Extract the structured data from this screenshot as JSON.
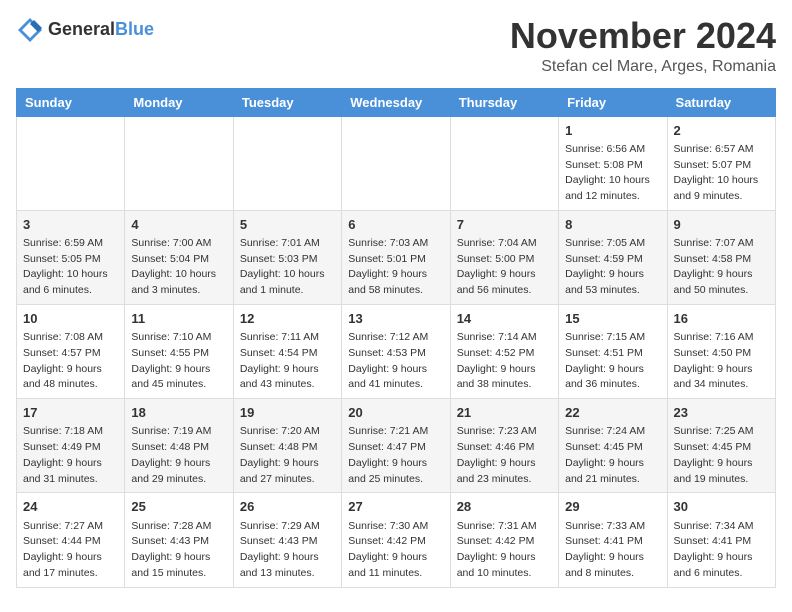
{
  "logo": {
    "general": "General",
    "blue": "Blue"
  },
  "header": {
    "month": "November 2024",
    "location": "Stefan cel Mare, Arges, Romania"
  },
  "weekdays": [
    "Sunday",
    "Monday",
    "Tuesday",
    "Wednesday",
    "Thursday",
    "Friday",
    "Saturday"
  ],
  "weeks": [
    [
      {
        "day": "",
        "info": ""
      },
      {
        "day": "",
        "info": ""
      },
      {
        "day": "",
        "info": ""
      },
      {
        "day": "",
        "info": ""
      },
      {
        "day": "",
        "info": ""
      },
      {
        "day": "1",
        "info": "Sunrise: 6:56 AM\nSunset: 5:08 PM\nDaylight: 10 hours and 12 minutes."
      },
      {
        "day": "2",
        "info": "Sunrise: 6:57 AM\nSunset: 5:07 PM\nDaylight: 10 hours and 9 minutes."
      }
    ],
    [
      {
        "day": "3",
        "info": "Sunrise: 6:59 AM\nSunset: 5:05 PM\nDaylight: 10 hours and 6 minutes."
      },
      {
        "day": "4",
        "info": "Sunrise: 7:00 AM\nSunset: 5:04 PM\nDaylight: 10 hours and 3 minutes."
      },
      {
        "day": "5",
        "info": "Sunrise: 7:01 AM\nSunset: 5:03 PM\nDaylight: 10 hours and 1 minute."
      },
      {
        "day": "6",
        "info": "Sunrise: 7:03 AM\nSunset: 5:01 PM\nDaylight: 9 hours and 58 minutes."
      },
      {
        "day": "7",
        "info": "Sunrise: 7:04 AM\nSunset: 5:00 PM\nDaylight: 9 hours and 56 minutes."
      },
      {
        "day": "8",
        "info": "Sunrise: 7:05 AM\nSunset: 4:59 PM\nDaylight: 9 hours and 53 minutes."
      },
      {
        "day": "9",
        "info": "Sunrise: 7:07 AM\nSunset: 4:58 PM\nDaylight: 9 hours and 50 minutes."
      }
    ],
    [
      {
        "day": "10",
        "info": "Sunrise: 7:08 AM\nSunset: 4:57 PM\nDaylight: 9 hours and 48 minutes."
      },
      {
        "day": "11",
        "info": "Sunrise: 7:10 AM\nSunset: 4:55 PM\nDaylight: 9 hours and 45 minutes."
      },
      {
        "day": "12",
        "info": "Sunrise: 7:11 AM\nSunset: 4:54 PM\nDaylight: 9 hours and 43 minutes."
      },
      {
        "day": "13",
        "info": "Sunrise: 7:12 AM\nSunset: 4:53 PM\nDaylight: 9 hours and 41 minutes."
      },
      {
        "day": "14",
        "info": "Sunrise: 7:14 AM\nSunset: 4:52 PM\nDaylight: 9 hours and 38 minutes."
      },
      {
        "day": "15",
        "info": "Sunrise: 7:15 AM\nSunset: 4:51 PM\nDaylight: 9 hours and 36 minutes."
      },
      {
        "day": "16",
        "info": "Sunrise: 7:16 AM\nSunset: 4:50 PM\nDaylight: 9 hours and 34 minutes."
      }
    ],
    [
      {
        "day": "17",
        "info": "Sunrise: 7:18 AM\nSunset: 4:49 PM\nDaylight: 9 hours and 31 minutes."
      },
      {
        "day": "18",
        "info": "Sunrise: 7:19 AM\nSunset: 4:48 PM\nDaylight: 9 hours and 29 minutes."
      },
      {
        "day": "19",
        "info": "Sunrise: 7:20 AM\nSunset: 4:48 PM\nDaylight: 9 hours and 27 minutes."
      },
      {
        "day": "20",
        "info": "Sunrise: 7:21 AM\nSunset: 4:47 PM\nDaylight: 9 hours and 25 minutes."
      },
      {
        "day": "21",
        "info": "Sunrise: 7:23 AM\nSunset: 4:46 PM\nDaylight: 9 hours and 23 minutes."
      },
      {
        "day": "22",
        "info": "Sunrise: 7:24 AM\nSunset: 4:45 PM\nDaylight: 9 hours and 21 minutes."
      },
      {
        "day": "23",
        "info": "Sunrise: 7:25 AM\nSunset: 4:45 PM\nDaylight: 9 hours and 19 minutes."
      }
    ],
    [
      {
        "day": "24",
        "info": "Sunrise: 7:27 AM\nSunset: 4:44 PM\nDaylight: 9 hours and 17 minutes."
      },
      {
        "day": "25",
        "info": "Sunrise: 7:28 AM\nSunset: 4:43 PM\nDaylight: 9 hours and 15 minutes."
      },
      {
        "day": "26",
        "info": "Sunrise: 7:29 AM\nSunset: 4:43 PM\nDaylight: 9 hours and 13 minutes."
      },
      {
        "day": "27",
        "info": "Sunrise: 7:30 AM\nSunset: 4:42 PM\nDaylight: 9 hours and 11 minutes."
      },
      {
        "day": "28",
        "info": "Sunrise: 7:31 AM\nSunset: 4:42 PM\nDaylight: 9 hours and 10 minutes."
      },
      {
        "day": "29",
        "info": "Sunrise: 7:33 AM\nSunset: 4:41 PM\nDaylight: 9 hours and 8 minutes."
      },
      {
        "day": "30",
        "info": "Sunrise: 7:34 AM\nSunset: 4:41 PM\nDaylight: 9 hours and 6 minutes."
      }
    ]
  ]
}
